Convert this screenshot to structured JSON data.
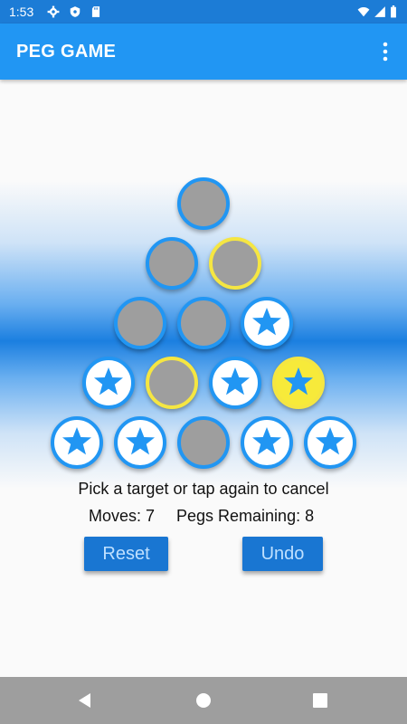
{
  "status_bar": {
    "time": "1:53",
    "left_icons": [
      "settings-icon",
      "shield-icon",
      "sd-card-icon"
    ],
    "right_icons": [
      "wifi-icon",
      "cellular-signal-icon",
      "battery-icon"
    ]
  },
  "app_bar": {
    "title": "PEG GAME",
    "menu_icon": "more-vert-icon"
  },
  "board": {
    "rows": [
      [
        "empty"
      ],
      [
        "empty",
        "empty-selected"
      ],
      [
        "empty",
        "empty",
        "filled"
      ],
      [
        "filled",
        "empty-selected",
        "filled",
        "filled-selected"
      ],
      [
        "filled",
        "filled",
        "empty",
        "filled",
        "filled"
      ]
    ],
    "peg_icon": "star-icon",
    "colors": {
      "peg_border": "#2196f3",
      "selected_border": "#f5e642",
      "selected_fill": "#f7ea3a",
      "empty_hole": "#9e9e9e",
      "star": "#2196f3"
    }
  },
  "message": "Pick a target or tap again to cancel",
  "stats": {
    "moves_label": "Moves:",
    "moves_value": "7",
    "pegs_label": "Pegs Remaining:",
    "pegs_value": "8"
  },
  "buttons": {
    "reset": "Reset",
    "undo": "Undo"
  },
  "nav_bar": {
    "back": "back-icon",
    "home": "home-icon",
    "recents": "recents-icon"
  },
  "colors": {
    "status_bar": "#1c7cd6",
    "app_bar": "#2196f3",
    "button": "#1976d2",
    "button_text": "#bfe0ff",
    "nav_bar": "#9e9e9e"
  }
}
